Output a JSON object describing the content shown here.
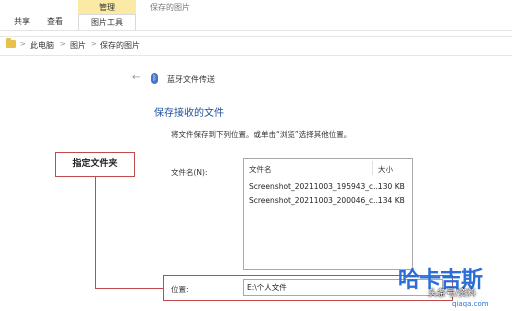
{
  "ribbon": {
    "context_group": "管理",
    "context_title": "保存的图片",
    "tabs": [
      "共享",
      "查看",
      "图片工具"
    ]
  },
  "address": {
    "crumbs": [
      "此电脑",
      "图片",
      "保存的图片"
    ],
    "separator": ">"
  },
  "wizard": {
    "back_icon": "left-arrow-icon",
    "title": "蓝牙文件传送",
    "heading": "保存接收的文件",
    "instruction": "将文件保存到下列位置。或单击“浏览”选择其他位置。",
    "filename_label": "文件名(N):",
    "columns": [
      "文件名",
      "大小"
    ],
    "files": [
      {
        "name": "Screenshot_20211003_195943_c...",
        "size": "130 KB"
      },
      {
        "name": "Screenshot_20211003_200046_c...",
        "size": "134 KB"
      }
    ],
    "location_label": "位置:",
    "location_value": "E:\\个人文件"
  },
  "annotation": {
    "callout": "指定文件夹",
    "color": "#c04b4b"
  },
  "watermark": {
    "logo": "哈卡吉斯",
    "sub": "qiaqa.com",
    "overlay": "头条号/资料"
  }
}
